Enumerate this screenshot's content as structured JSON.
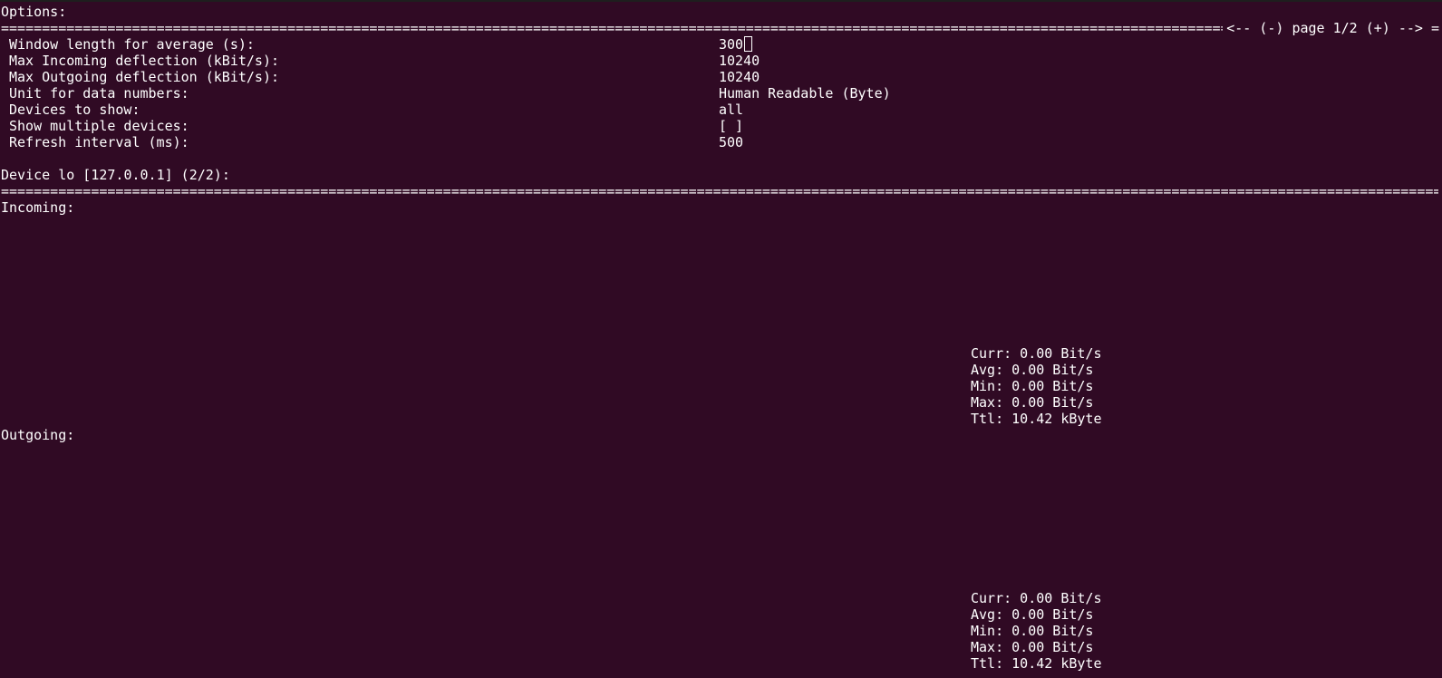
{
  "options": {
    "title": "Options:",
    "separator": "================================================================================================================================================================",
    "pager": {
      "prev": "<--",
      "minus": "(-)",
      "page": "page 1/2",
      "plus": "(+)",
      "next": "-->",
      "end": "="
    },
    "items": [
      {
        "label": "Window length for average (s):",
        "value": "300"
      },
      {
        "label": "Max Incoming deflection (kBit/s):",
        "value": "10240"
      },
      {
        "label": "Max Outgoing deflection (kBit/s):",
        "value": "10240"
      },
      {
        "label": "Unit for data numbers:",
        "value": "Human Readable (Byte)"
      },
      {
        "label": "Devices to show:",
        "value": "all"
      },
      {
        "label": "Show multiple devices:",
        "value": "[ ]"
      },
      {
        "label": "Refresh interval (ms):",
        "value": "500"
      }
    ]
  },
  "device": {
    "title": "Device lo [127.0.0.1] (2/2):",
    "separator": "========================================================================================================================================================================================="
  },
  "incoming": {
    "title": "Incoming:",
    "curr": "Curr: 0.00 Bit/s",
    "avg": "Avg: 0.00 Bit/s",
    "min": "Min: 0.00 Bit/s",
    "max": "Max: 0.00 Bit/s",
    "ttl": "Ttl: 10.42 kByte"
  },
  "outgoing": {
    "title": "Outgoing:",
    "curr": "Curr: 0.00 Bit/s",
    "avg": "Avg: 0.00 Bit/s",
    "min": "Min: 0.00 Bit/s",
    "max": "Max: 0.00 Bit/s",
    "ttl": "Ttl: 10.42 kByte"
  },
  "colors": {
    "background": "#300a24",
    "foreground": "#ffffff"
  }
}
